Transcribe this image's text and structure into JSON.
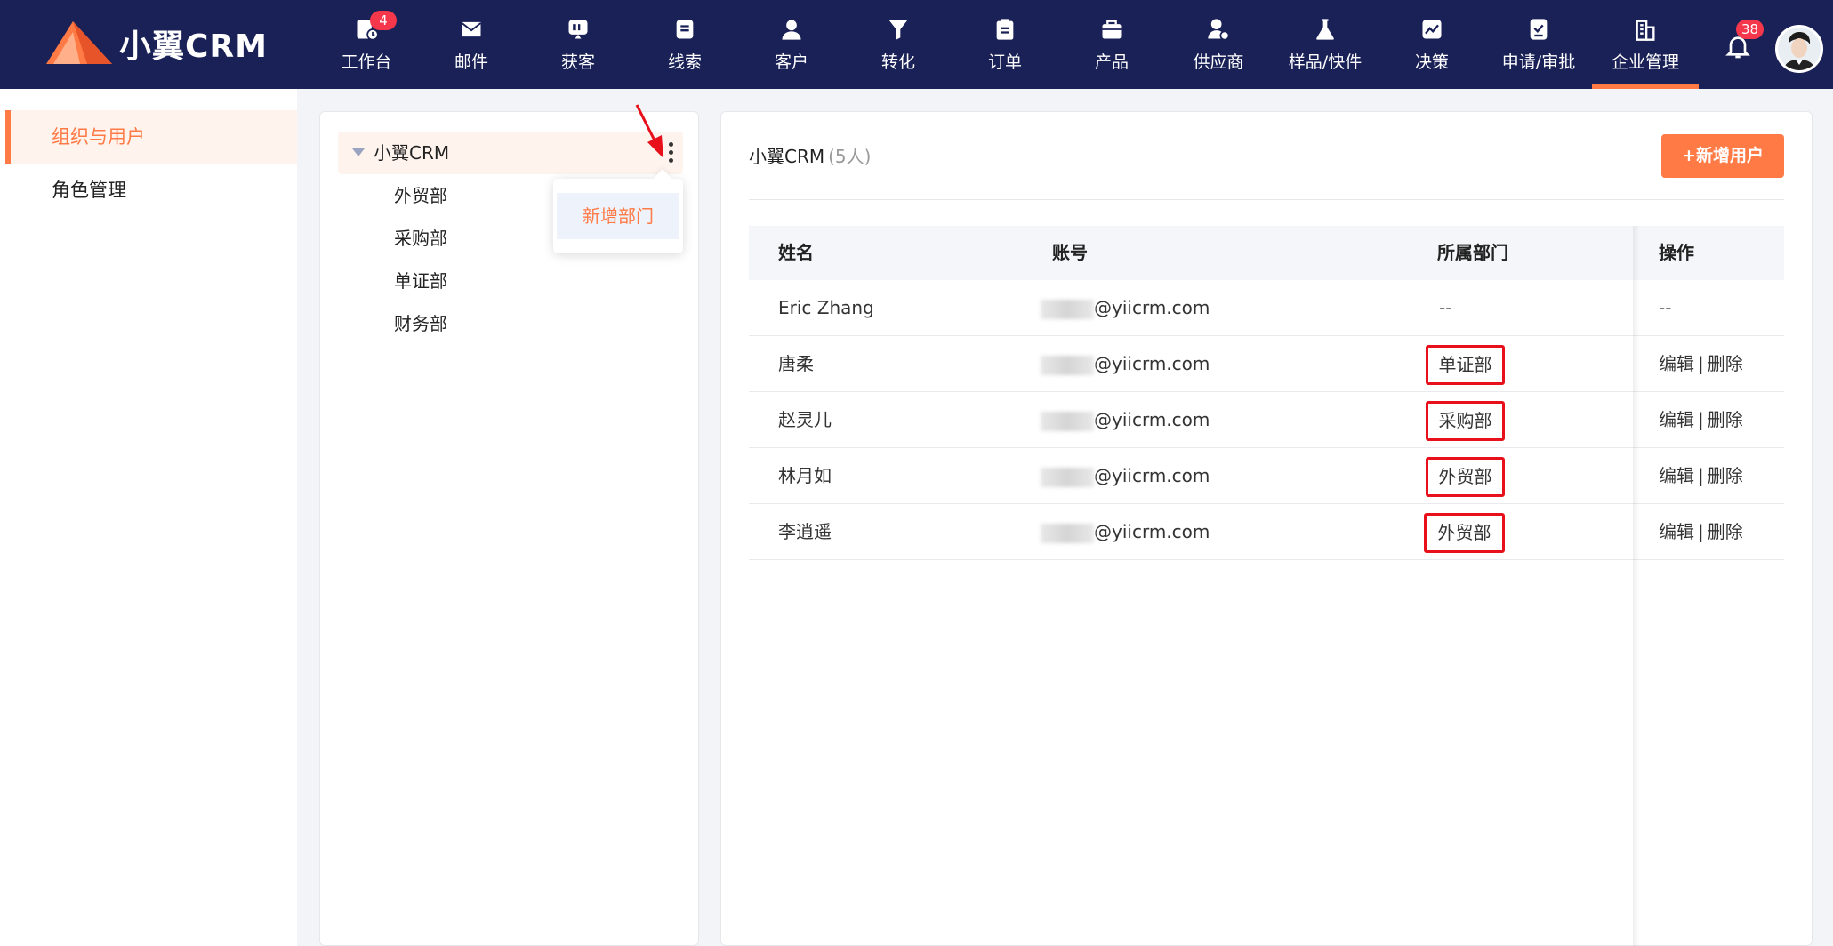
{
  "app": {
    "logo_text": "小翼CRM",
    "accent": "#ff7a45",
    "nav_bg": "#1a2156",
    "alert_red": "#e8101a"
  },
  "nav": {
    "items": [
      {
        "label": "工作台",
        "icon": "dashboard-icon",
        "badge": "4"
      },
      {
        "label": "邮件",
        "icon": "mail-icon"
      },
      {
        "label": "获客",
        "icon": "acquire-icon"
      },
      {
        "label": "线索",
        "icon": "leads-icon"
      },
      {
        "label": "客户",
        "icon": "customer-icon"
      },
      {
        "label": "转化",
        "icon": "funnel-icon"
      },
      {
        "label": "订单",
        "icon": "order-icon"
      },
      {
        "label": "产品",
        "icon": "product-icon"
      },
      {
        "label": "供应商",
        "icon": "supplier-icon"
      },
      {
        "label": "样品/快件",
        "icon": "sample-icon"
      },
      {
        "label": "决策",
        "icon": "chart-icon"
      },
      {
        "label": "申请/审批",
        "icon": "approval-icon"
      },
      {
        "label": "企业管理",
        "icon": "enterprise-icon",
        "active": true
      }
    ],
    "bell_badge": "38"
  },
  "sidebar": {
    "items": [
      {
        "label": "组织与用户",
        "active": true
      },
      {
        "label": "角色管理"
      }
    ]
  },
  "tree": {
    "root": "小翼CRM",
    "children": [
      "外贸部",
      "采购部",
      "单证部",
      "财务部"
    ],
    "popover_item": "新增部门"
  },
  "main": {
    "title": "小翼CRM",
    "count": "(5人)",
    "add_button": "+新增用户",
    "columns": [
      "姓名",
      "账号",
      "所属部门",
      "操作"
    ],
    "rows": [
      {
        "name": "Eric Zhang",
        "email": "@yiicrm.com",
        "dept": "--",
        "ops": "--"
      },
      {
        "name": "唐柔",
        "email": "@yiicrm.com",
        "dept": "单证部",
        "edit": "编辑",
        "sep": "|",
        "del": "删除"
      },
      {
        "name": "赵灵儿",
        "email": "@yiicrm.com",
        "dept": "采购部",
        "edit": "编辑",
        "sep": "|",
        "del": "删除"
      },
      {
        "name": "林月如",
        "email": "@yiicrm.com",
        "dept": "外贸部",
        "edit": "编辑",
        "sep": "|",
        "del": "删除"
      },
      {
        "name": "李逍遥",
        "email": "@yiicrm.com",
        "dept": "外贸部",
        "edit": "编辑",
        "sep": "|",
        "del": "删除"
      }
    ]
  }
}
